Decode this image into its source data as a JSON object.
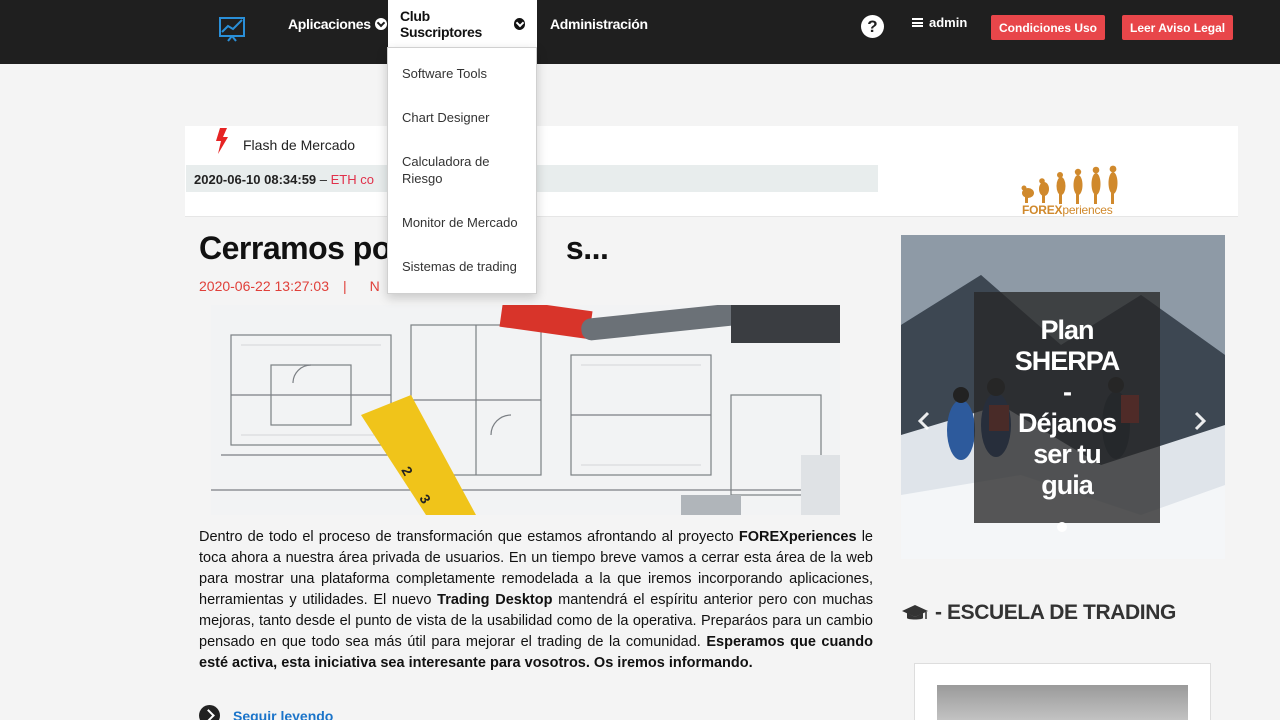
{
  "nav": {
    "items": [
      {
        "label": "Aplicaciones",
        "has_menu": true
      },
      {
        "label": "Club Suscriptores",
        "has_menu": true,
        "active": true
      },
      {
        "label": "Administración",
        "has_menu": false
      }
    ],
    "help": "?",
    "user": "admin",
    "buttons": [
      "Condiciones Uso",
      "Leer Aviso Legal"
    ]
  },
  "dropdown": {
    "items": [
      "Software Tools",
      "Chart Designer",
      "Calculadora de Riesgo",
      "Monitor de Mercado",
      "Sistemas de trading"
    ]
  },
  "flash": {
    "title": "Flash de Mercado",
    "timestamp": "2020-06-10 08:34:59",
    "dash": "–",
    "text": "ETH co"
  },
  "brand": {
    "bold": "FOREX",
    "rest": "periences"
  },
  "article": {
    "title": "Cerramos po",
    "title_tail": "s...",
    "date": "2020-06-22 13:27:03",
    "separator": "|",
    "meta_tail": "N",
    "body": [
      {
        "t": "Dentro de todo el proceso de transformación que estamos afrontando al proyecto "
      },
      {
        "t": "FOREXperiences",
        "b": true
      },
      {
        "t": " le toca ahora a nuestra área privada de usuarios. En un tiempo breve vamos a cerrar esta área de la web para mostrar una plataforma completamente remodelada a la que iremos incorporando aplicaciones, herramientas y utilidades. El nuevo "
      },
      {
        "t": "Trading Desktop",
        "b": true
      },
      {
        "t": " mantendrá el espíritu anterior pero con muchas mejoras, tanto desde el punto de vista de la usabilidad como de la operativa. Preparáos para un cambio pensado en que todo sea más útil para mejorar el trading de la comunidad. "
      },
      {
        "t": "Esperamos que cuando esté activa, esta iniciativa sea interesante para vosotros. Os iremos informando.",
        "b": true
      }
    ],
    "read_more": "Seguir leyendo"
  },
  "carousel": {
    "caption_lines": [
      "Plan",
      "SHERPA",
      "-",
      "Déjanos",
      "ser tu",
      "guia"
    ]
  },
  "school": {
    "title": "- ESCUELA DE TRADING",
    "icon": "graduation-cap-icon"
  },
  "colors": {
    "nav_bg": "#1f1f1f",
    "accent_red": "#e8464a",
    "link_blue": "#1b74c9",
    "brand_gold": "#d0892c"
  }
}
